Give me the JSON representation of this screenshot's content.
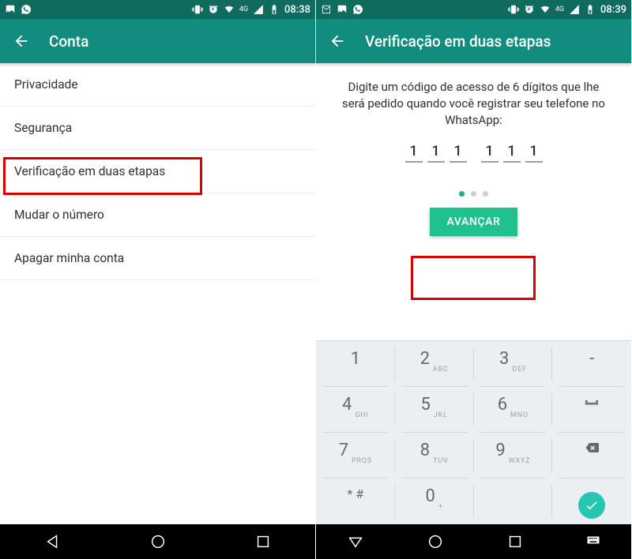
{
  "status": {
    "time_left": "08:38",
    "time_right": "08:39",
    "network_label": "4G"
  },
  "screen1": {
    "title": "Conta",
    "items": [
      {
        "label": "Privacidade"
      },
      {
        "label": "Segurança"
      },
      {
        "label": "Verificação em duas etapas"
      },
      {
        "label": "Mudar o número"
      },
      {
        "label": "Apagar minha conta"
      }
    ]
  },
  "screen2": {
    "title": "Verificação em duas etapas",
    "instructions": "Digite um código de acesso de 6 dígitos que lhe será pedido quando você registrar seu telefone no WhatsApp:",
    "pin": [
      "1",
      "1",
      "1",
      "1",
      "1",
      "1"
    ],
    "advance_label": "AVANÇAR",
    "keypad": {
      "1": {
        "num": "1",
        "sub": ""
      },
      "2": {
        "num": "2",
        "sub": "ABC"
      },
      "3": {
        "num": "3",
        "sub": "DEF"
      },
      "dash": {
        "num": "-",
        "sub": ""
      },
      "4": {
        "num": "4",
        "sub": "GHI"
      },
      "5": {
        "num": "5",
        "sub": "JKL"
      },
      "6": {
        "num": "6",
        "sub": "MNO"
      },
      "7": {
        "num": "7",
        "sub": "PRQS"
      },
      "8": {
        "num": "8",
        "sub": "TUV"
      },
      "9": {
        "num": "9",
        "sub": "WXYZ"
      },
      "star": {
        "num": "* #",
        "sub": ""
      },
      "0": {
        "num": "0",
        "sub": "+"
      }
    }
  }
}
